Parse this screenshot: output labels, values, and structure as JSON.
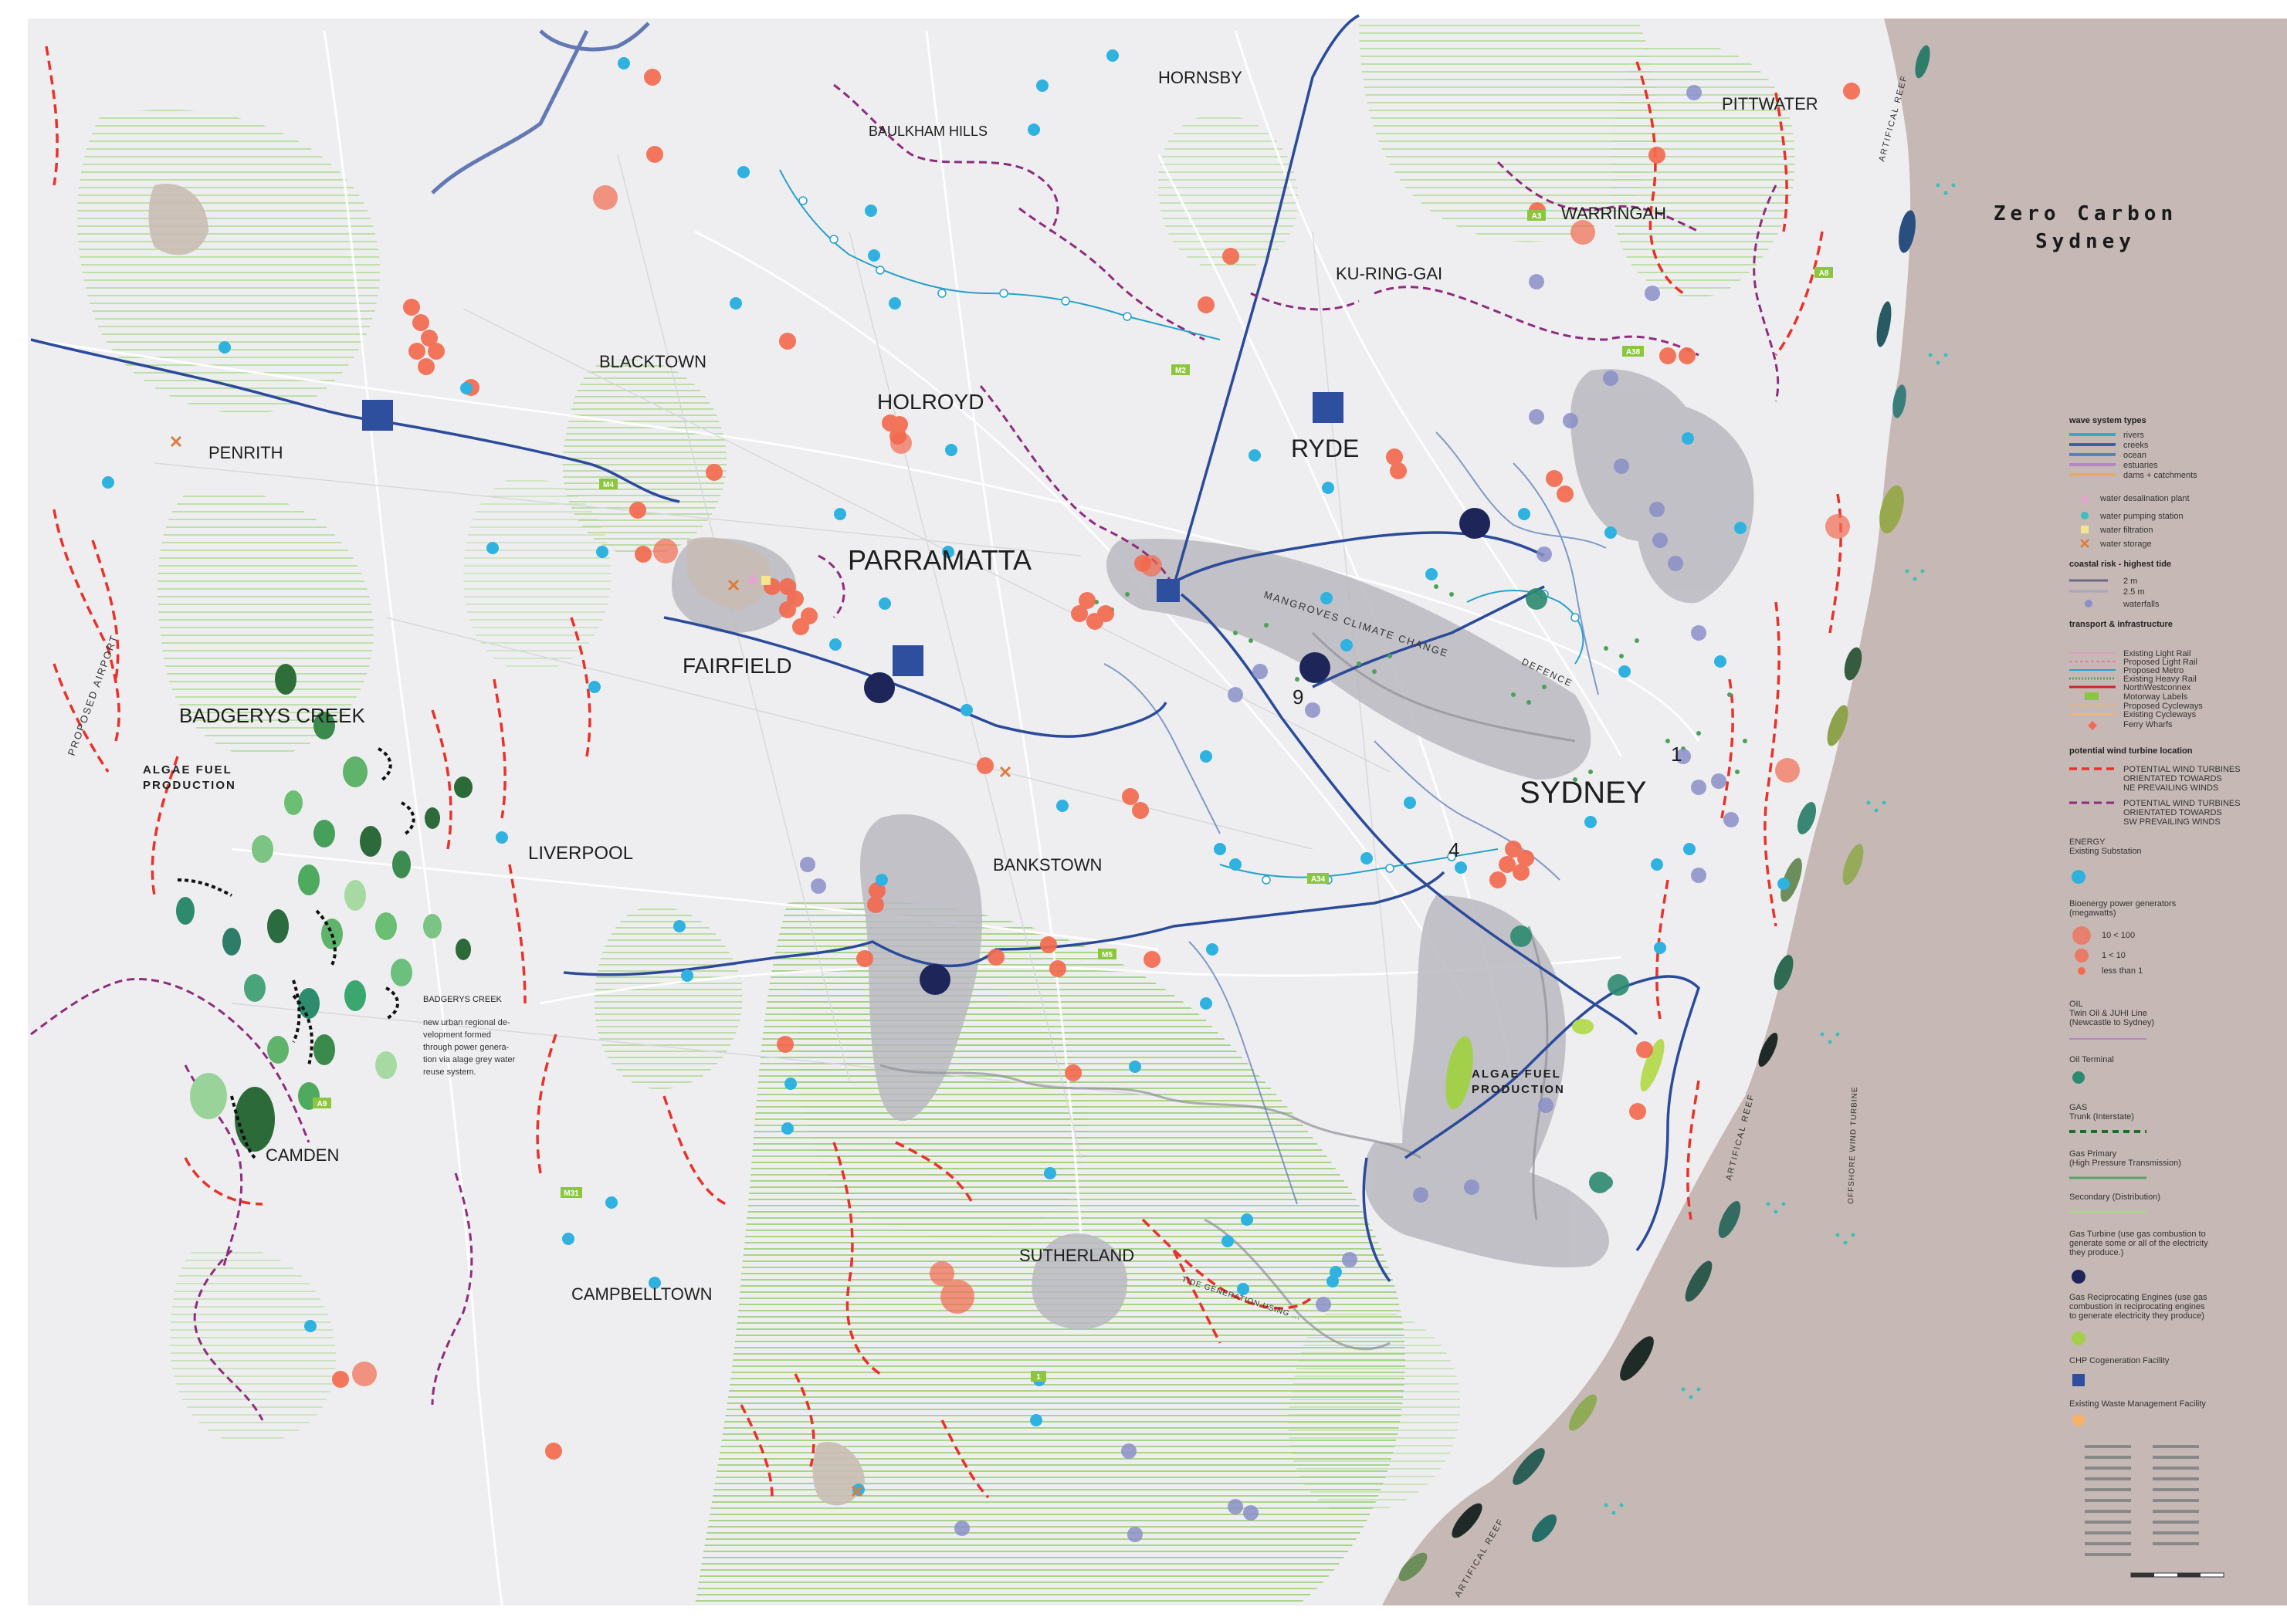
{
  "title": {
    "line1": "Zero Carbon",
    "line2": "Sydney"
  },
  "places": {
    "hornsby": "HORNSBY",
    "pittwater": "PITTWATER",
    "baulkham_hills": "BAULKHAM HILLS",
    "warringah": "WARRINGAH",
    "ku_ring_gai": "KU-RING-GAI",
    "blacktown": "BLACKTOWN",
    "holroyd": "HOLROYD",
    "ryde": "RYDE",
    "penrith": "PENRITH",
    "parramatta": "PARRAMATTA",
    "fairfield": "FAIRFIELD",
    "badgerys_creek": "BADGERYS CREEK",
    "liverpool": "LIVERPOOL",
    "bankstown": "BANKSTOWN",
    "sydney": "SYDNEY",
    "camden": "CAMDEN",
    "sutherland": "SUTHERLAND",
    "campbelltown": "CAMPBELLTOWN"
  },
  "annotations": {
    "algae_left_1": "ALGAE FUEL",
    "algae_left_2": "PRODUCTION",
    "algae_right_1": "ALGAE FUEL",
    "algae_right_2": "PRODUCTION",
    "proposed_airport": "PROPOSED AIRPORT",
    "mangroves": "MANGROVES CLIMATE CHANGE",
    "defence": "DEFENCE",
    "artifical_reef": "ARTIFICAL REEF",
    "offshore_wind": "OFFSHORE WIND TURBINE",
    "tide_generation": "TIDE GENERATION USING ...",
    "badgerys_note_title": "BADGERYS CREEK",
    "badgerys_note_1": "new urban regional de-",
    "badgerys_note_2": "velopment formed",
    "badgerys_note_3": "through power genera-",
    "badgerys_note_4": "tion via alage grey water",
    "badgerys_note_5": "reuse system.",
    "num_9": "9",
    "num_1": "1",
    "num_4": "4"
  },
  "motorways": [
    "M4",
    "M2",
    "A3",
    "A8",
    "A38",
    "A34",
    "M5",
    "A9",
    "M31",
    "1"
  ],
  "legend": {
    "wave_header": "wave system types",
    "rivers": "rivers",
    "creeks": "creeks",
    "ocean": "ocean",
    "estuaries": "estuaries",
    "dams": "dams + catchments",
    "desal": "water desalination plant",
    "pumping": "water pumping station",
    "filtration": "water filtration",
    "storage": "water storage",
    "coastal_header": "coastal risk - highest tide",
    "tide_2m": "2 m",
    "tide_25m": "2.5 m",
    "waterfalls": "waterfalls",
    "transport_header": "transport & infrastructure",
    "light_rail": "Existing Light Rail",
    "prop_light_rail": "Proposed Light Rail",
    "prop_metro": "Proposed Metro",
    "heavy_rail": "Existing Heavy Rail",
    "northwest": "NorthWestconnex",
    "motorway_labels": "Motorway Labels",
    "prop_cycle": "Proposed Cycleways",
    "exist_cycle": "Existing Cycleways",
    "ferry": "Ferry Wharfs",
    "wind_header": "potential wind turbine location",
    "wind_ne_1": "POTENTIAL WIND TURBINES",
    "wind_ne_2": "ORIENTATED TOWARDS",
    "wind_ne_3": "NE PREVAILING WINDS",
    "wind_sw_1": "POTENTIAL WIND TURBINES",
    "wind_sw_2": "ORIENTATED TOWARDS",
    "wind_sw_3": "SW PREVAILING WINDS",
    "energy_1": "ENERGY",
    "energy_2": "Existing Substation",
    "bio_1": "Bioenergy power generators",
    "bio_2": "(megawatts)",
    "bio_a": "10 < 100",
    "bio_b": "1 < 10",
    "bio_c": "less than 1",
    "oil_1": "OIL",
    "oil_2": "Twin Oil & JUHI Line",
    "oil_3": "(Newcastle to Sydney)",
    "oil_terminal": "Oil Terminal",
    "gas_1": "GAS",
    "gas_2": "Trunk (Interstate)",
    "gas_primary_1": "Gas Primary",
    "gas_primary_2": "(High Pressure Transmission)",
    "secondary": "Secondary (Distribution)",
    "turbine_1": "Gas Turbine (use gas combustion to",
    "turbine_2": "generate some or all of the electricity",
    "turbine_3": "they produce.)",
    "recip_1": "Gas Reciprocating Engines (use gas",
    "recip_2": "combustion in reciprocating engines",
    "recip_3": "to generate electricity they produce)",
    "chp": "CHP Cogeneration Facility",
    "waste": "Existing Waste Management Facility"
  },
  "colors": {
    "land": "#f0f0f1",
    "ocean": "#c9bcb8",
    "green_hatch": "#8fca63",
    "wind_ne": "#e8322a",
    "wind_sw": "#8e2c7d",
    "transmission": "#2c4f9e",
    "bio": "#f26a4f",
    "substation": "#2fb2e0",
    "gas_turbine": "#1e2659",
    "chp": "#2e4f9e",
    "purple_circle": "#8a8fc8"
  }
}
